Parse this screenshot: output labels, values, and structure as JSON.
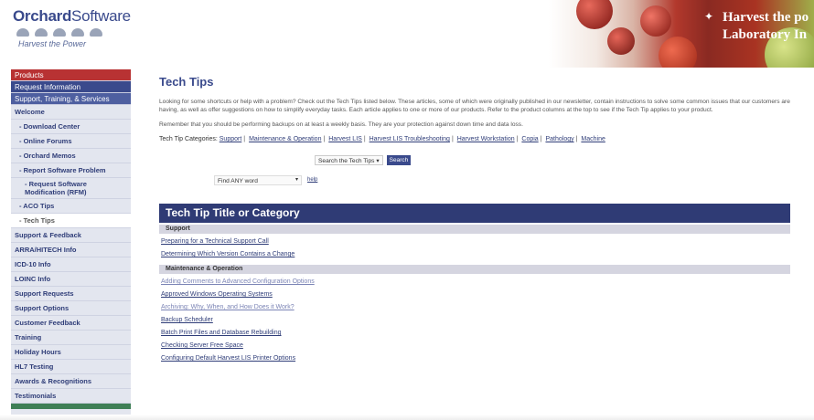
{
  "brand": {
    "name_bold": "Orchard",
    "name_light": "Software",
    "tagline": "Harvest the Power"
  },
  "banner": {
    "line1": "Harvest the po",
    "line2": "Laboratory In"
  },
  "sidebar": {
    "top_items": [
      {
        "label": "Products",
        "style": "red"
      },
      {
        "label": "Request Information",
        "style": "navy"
      },
      {
        "label": "Support, Training, & Services",
        "style": "active"
      }
    ],
    "items": [
      {
        "label": "Welcome",
        "level": 1
      },
      {
        "label": "- Download Center",
        "level": 2
      },
      {
        "label": "- Online Forums",
        "level": 2
      },
      {
        "label": "- Orchard Memos",
        "level": 2
      },
      {
        "label": "- Report Software Problem",
        "level": 2
      },
      {
        "label": "- Request Software Modification (RFM)",
        "level": 3
      },
      {
        "label": "- ACO Tips",
        "level": 2
      },
      {
        "label": "- Tech Tips",
        "level": 2,
        "current": true
      },
      {
        "label": "Support & Feedback",
        "level": 1
      },
      {
        "label": "ARRA/HITECH Info",
        "level": 1
      },
      {
        "label": "ICD-10 Info",
        "level": 1
      },
      {
        "label": "LOINC Info",
        "level": 1
      },
      {
        "label": "Support Requests",
        "level": 1
      },
      {
        "label": "Support Options",
        "level": 1
      },
      {
        "label": "Customer Feedback",
        "level": 1
      },
      {
        "label": "Training",
        "level": 1
      },
      {
        "label": "Holiday Hours",
        "level": 1
      },
      {
        "label": "HL7 Testing",
        "level": 1
      },
      {
        "label": "Awards & Recognitions",
        "level": 1
      },
      {
        "label": "Testimonials",
        "level": 1
      }
    ]
  },
  "main": {
    "title": "Tech Tips",
    "intro": "Looking for some shortcuts or help with a problem? Check out the Tech Tips listed below. These articles, some of which were originally published in our newsletter, contain instructions to solve some common issues that our customers are having, as well as offer suggestions on how to simplify everyday tasks. Each article applies to one or more of our products. Refer to the product columns at the top to see if the Tech Tip applies to your product.",
    "reminder": "Remember that you should be performing backups on at least a weekly basis. They are your protection against down time and data loss.",
    "categories_label": "Tech Tip Categories:",
    "categories": [
      "Support",
      "Maintenance & Operation",
      "Harvest LIS",
      "Harvest LIS Troubleshooting",
      "Harvest Workstation",
      "Copia",
      "Pathology",
      "Machine"
    ],
    "search_select": "Search the Tech Tips",
    "search_button": "Search",
    "find_select": "Find ANY word",
    "find_help": "help"
  },
  "tips": {
    "header": "Tech Tip Title or Category",
    "sections": [
      {
        "name": "Support",
        "links": [
          "Preparing for a Technical Support Call",
          "Determining Which Version Contains a Change"
        ]
      },
      {
        "name": "Maintenance & Operation",
        "links": [
          "Adding Comments to Advanced Configuration Options",
          "Approved Windows Operating Systems",
          "Archiving: Why, When, and How Does it Work?",
          "Backup Scheduler",
          "Batch Print Files and Database Rebuilding",
          "Checking Server Free Space",
          "Configuring Default Harvest LIS Printer Options"
        ]
      }
    ]
  }
}
